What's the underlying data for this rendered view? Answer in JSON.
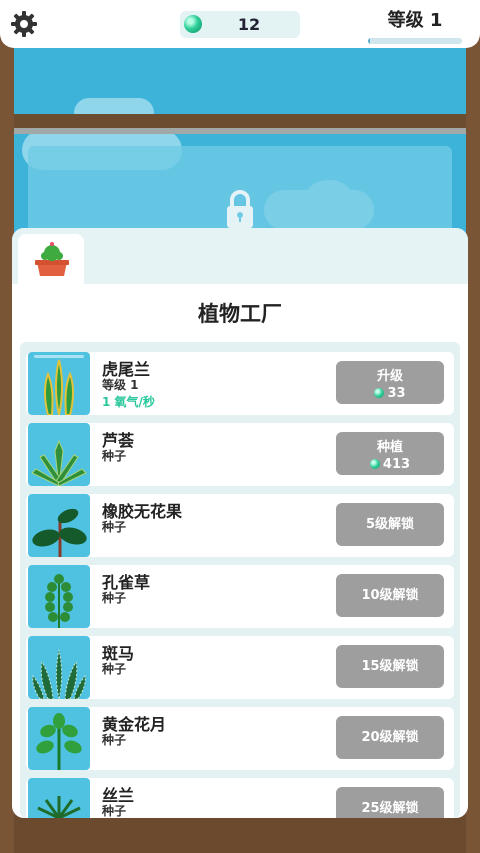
{
  "header": {
    "oxygen_count": "12",
    "level_label": "等级 1",
    "level_progress": 0.02
  },
  "panel": {
    "title": "植物工厂"
  },
  "plants": [
    {
      "name": "虎尾兰",
      "status": "等级 1",
      "rate": "1 氧气/秒",
      "button_line1": "升级",
      "button_cost": "33"
    },
    {
      "name": "芦荟",
      "status": "种子",
      "button_line1": "种植",
      "button_cost": "413"
    },
    {
      "name": "橡胶无花果",
      "status": "种子",
      "button_label": "5级解锁"
    },
    {
      "name": "孔雀草",
      "status": "种子",
      "button_label": "10级解锁"
    },
    {
      "name": "斑马",
      "status": "种子",
      "button_label": "15级解锁"
    },
    {
      "name": "黄金花月",
      "status": "种子",
      "button_label": "20级解锁"
    },
    {
      "name": "丝兰",
      "status": "种子",
      "button_label": "25级解锁"
    }
  ],
  "colors": {
    "sky": "#3db3d9",
    "wood": "#7a5535",
    "button_gray": "#9e9e9e",
    "oxygen_green": "#27c79b"
  }
}
